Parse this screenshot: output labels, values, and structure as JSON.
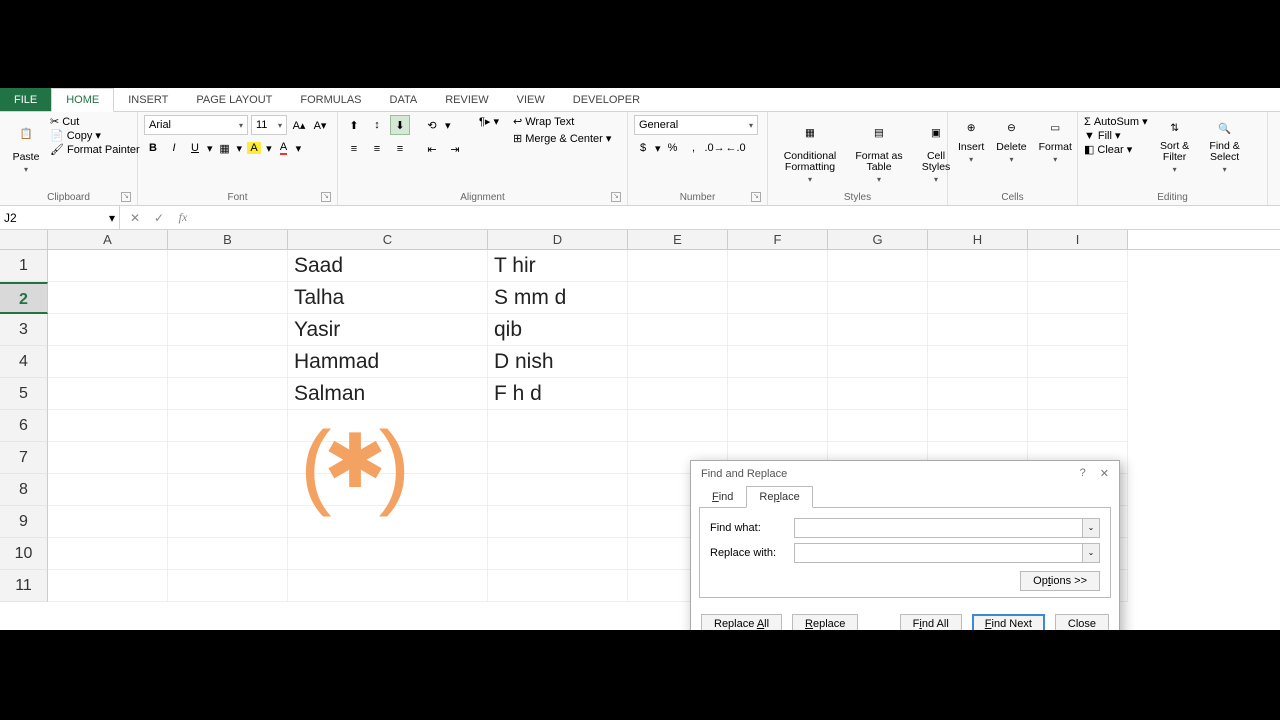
{
  "tabs": {
    "file": "FILE",
    "home": "HOME",
    "insert": "INSERT",
    "page_layout": "PAGE LAYOUT",
    "formulas": "FORMULAS",
    "data": "DATA",
    "review": "REVIEW",
    "view": "VIEW",
    "developer": "DEVELOPER"
  },
  "clipboard": {
    "paste": "Paste",
    "cut": "Cut",
    "copy": "Copy",
    "format_painter": "Format Painter",
    "label": "Clipboard"
  },
  "font": {
    "name": "Arial",
    "size": "11",
    "label": "Font"
  },
  "alignment": {
    "wrap": "Wrap Text",
    "merge": "Merge & Center",
    "label": "Alignment"
  },
  "number": {
    "format": "General",
    "label": "Number"
  },
  "styles": {
    "cond": "Conditional Formatting",
    "table": "Format as Table",
    "cell": "Cell Styles",
    "label": "Styles"
  },
  "cells": {
    "insert": "Insert",
    "delete": "Delete",
    "format": "Format",
    "label": "Cells"
  },
  "editing": {
    "autosum": "AutoSum",
    "fill": "Fill",
    "clear": "Clear",
    "sort": "Sort & Filter",
    "find": "Find & Select",
    "label": "Editing"
  },
  "namebox": "J2",
  "cols": [
    "A",
    "B",
    "C",
    "D",
    "E",
    "F",
    "G",
    "H",
    "I"
  ],
  "rows": [
    "1",
    "2",
    "3",
    "4",
    "5",
    "6",
    "7",
    "8",
    "9",
    "10",
    "11"
  ],
  "selected_row": "2",
  "cells_data": {
    "C1": "Saad",
    "D1": "T hir",
    "C2": "Talha",
    "D2": "S mm d",
    "C3": "Yasir",
    "D3": " qib",
    "C4": "Hammad",
    "D4": "D nish",
    "C5": "Salman",
    "D5": "F h d"
  },
  "dialog": {
    "title": "Find and Replace",
    "tab_find": "Find",
    "tab_replace": "Replace",
    "find_what": "Find what:",
    "replace_with": "Replace with:",
    "find_value": "",
    "replace_value": "",
    "options": "Options >>",
    "replace_all": "Replace All",
    "replace": "Replace",
    "find_all": "Find All",
    "find_next": "Find Next",
    "close": "Close"
  }
}
